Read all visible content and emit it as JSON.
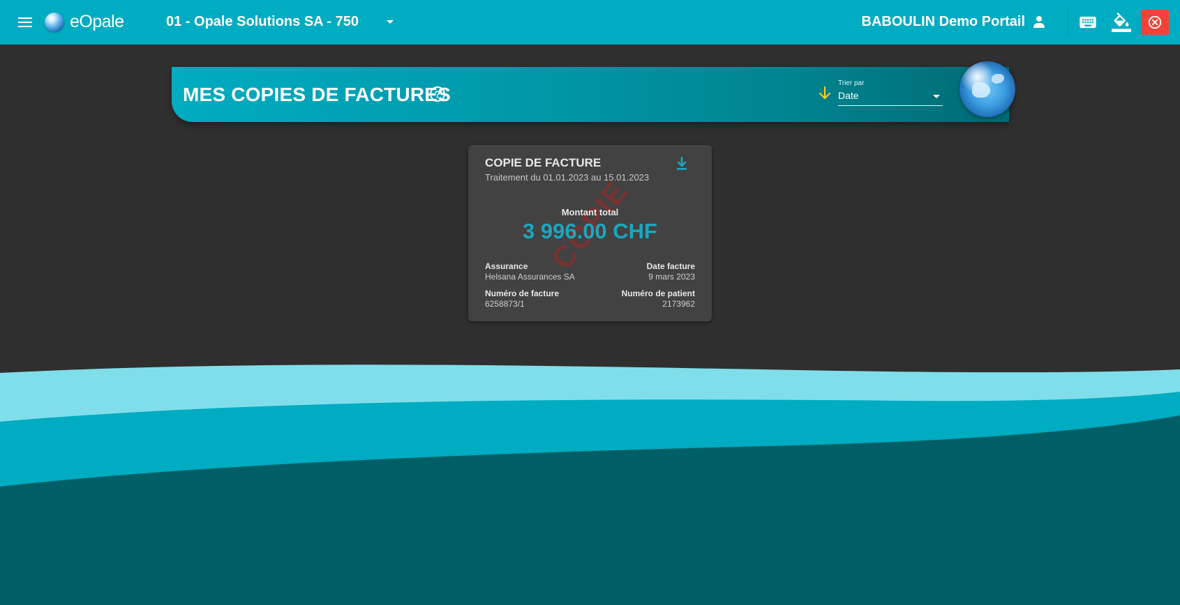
{
  "app": {
    "logo_text": "eOpale",
    "company": "01 - Opale Solutions SA - 750",
    "user": "BABOULIN Demo Portail"
  },
  "toolbar": {
    "icons": [
      "menu-icon",
      "keyboard-icon",
      "paint-bucket-icon",
      "close-icon"
    ],
    "close_color": "#f44336",
    "bar_color": "#00acc1"
  },
  "page": {
    "title": "MES COPIES DE FACTURES",
    "sort": {
      "label": "Trier par",
      "value": "Date"
    }
  },
  "card": {
    "title": "COPIE DE FACTURE",
    "subtitle": "Traitement du 01.01.2023 au 15.01.2023",
    "watermark": "COPIE",
    "total_label": "Montant total",
    "total_value": "3 996.00 CHF",
    "assurance_label": "Assurance",
    "assurance_value": "Helsana Assurances SA",
    "date_label": "Date facture",
    "date_value": "9 mars 2023",
    "invoice_number_label": "Numéro de facture",
    "invoice_number_value": "6258873/1",
    "patient_number_label": "Numéro de patient",
    "patient_number_value": "2173962"
  },
  "colors": {
    "accent": "#1ba7bd",
    "sort_arrow": "#ffca28",
    "wave_light": "#80deea",
    "wave_mid": "#00acc1",
    "wave_dark": "#005f66"
  }
}
